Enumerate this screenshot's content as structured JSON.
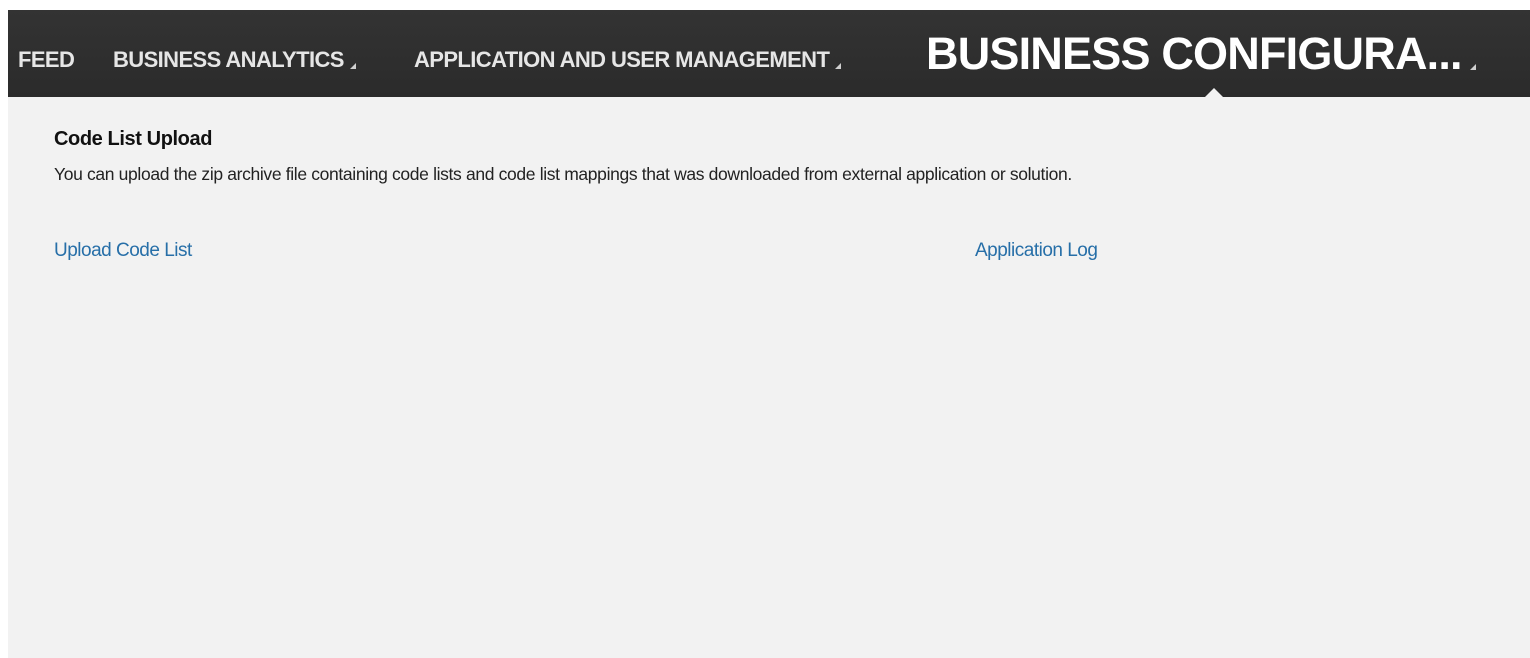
{
  "nav": {
    "items": [
      {
        "label": "FEED",
        "has_caret": false
      },
      {
        "label": "BUSINESS ANALYTICS",
        "has_caret": true
      },
      {
        "label": "APPLICATION AND USER MANAGEMENT",
        "has_caret": true
      },
      {
        "label": "BUSINESS CONFIGURA...",
        "has_caret": true,
        "active": true
      }
    ]
  },
  "section": {
    "title": "Code List Upload",
    "description": "You can upload the zip archive file containing code lists and code list mappings that was downloaded from external application or solution."
  },
  "links": {
    "upload_code_list": "Upload Code List",
    "application_log": "Application Log"
  },
  "colors": {
    "nav_background": "#2f2f2f",
    "page_background": "#f2f2f2",
    "link": "#276fa8"
  },
  "icons": {
    "dropdown_caret": "caret-icon"
  }
}
